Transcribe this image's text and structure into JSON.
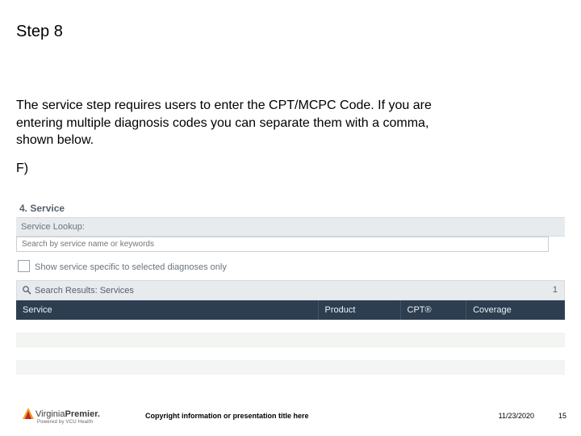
{
  "title": "Step 8",
  "body": "The service step requires users to enter the CPT/MCPC Code. If you are entering multiple diagnosis codes you can separate them with a comma, shown below.",
  "list_marker": "F)",
  "panel": {
    "section_title": "4. Service",
    "lookup_label": "Service Lookup:",
    "search_placeholder": "Search by service name or keywords",
    "checkbox_label": "Show service specific to selected diagnoses only",
    "results_title": "Search Results: Services",
    "results_count": "1",
    "columns": {
      "service": "Service",
      "product": "Product",
      "cpt": "CPT®",
      "coverage": "Coverage"
    }
  },
  "footer": {
    "brand_a": "Virginia",
    "brand_b": "Premier.",
    "tagline": "Powered by VCU Health",
    "copyright": "Copyright information or presentation title here",
    "date": "11/23/2020",
    "page": "15"
  }
}
